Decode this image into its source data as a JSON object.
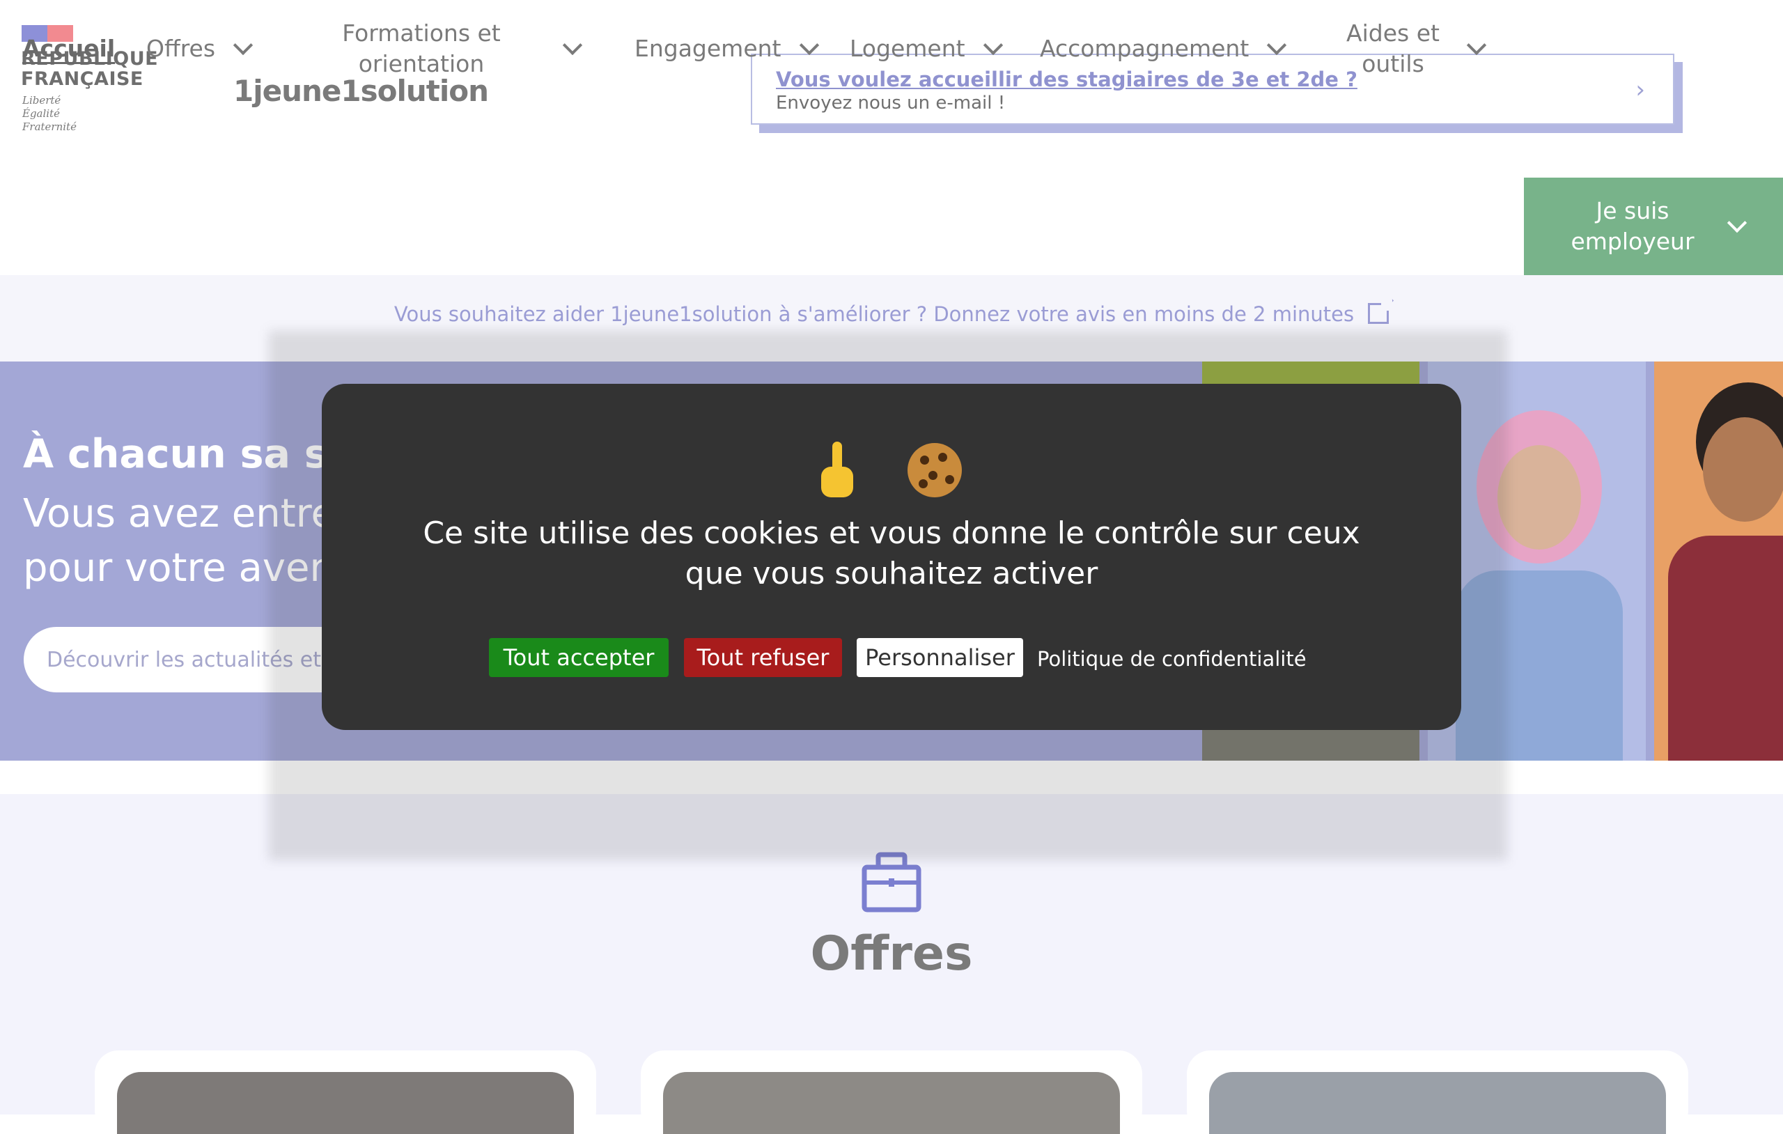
{
  "header": {
    "rf_name_line1": "RÉPUBLIQUE",
    "rf_name_line2": "FRANÇAISE",
    "rf_motto_line1": "Liberté",
    "rf_motto_line2": "Égalité",
    "rf_motto_line3": "Fraternité",
    "brand": "1jeune1solution"
  },
  "notice": {
    "title": "Vous voulez accueillir des stagiaires de 3e et 2de ?",
    "subtitle": "Envoyez nous un e-mail !",
    "chevron": "›"
  },
  "nav": {
    "items": [
      {
        "label": "Accueil"
      },
      {
        "label": "Offres"
      },
      {
        "label": "Formations et orientation"
      },
      {
        "label": "Engagement"
      },
      {
        "label": "Logement"
      },
      {
        "label": "Accompagnement"
      },
      {
        "label": "Aides et outils"
      },
      {
        "label": "Je suis employeur"
      }
    ]
  },
  "feedback": {
    "text": "Vous souhaitez aider 1jeune1solution à s'améliorer ? Donnez votre avis en moins de 2 minutes"
  },
  "hero": {
    "title": "À chacun sa sol",
    "subtitle_line1": "Vous avez entre",
    "subtitle_line2": "pour votre aven",
    "search_placeholder": "Découvrir les actualités et"
  },
  "cookie_modal": {
    "message": "Ce site utilise des cookies et vous donne le contrôle sur ceux que vous souhaitez activer",
    "accept": "Tout accepter",
    "refuse": "Tout refuser",
    "customize": "Personnaliser",
    "policy": "Politique de confidentialité"
  },
  "offers": {
    "title": "Offres",
    "icon": "briefcase-icon"
  },
  "colors": {
    "accent": "#8f92cf",
    "employer": "#78b38a",
    "accept": "#1a8a1a",
    "refuse": "#a81c1c",
    "modal_bg": "#333333"
  }
}
